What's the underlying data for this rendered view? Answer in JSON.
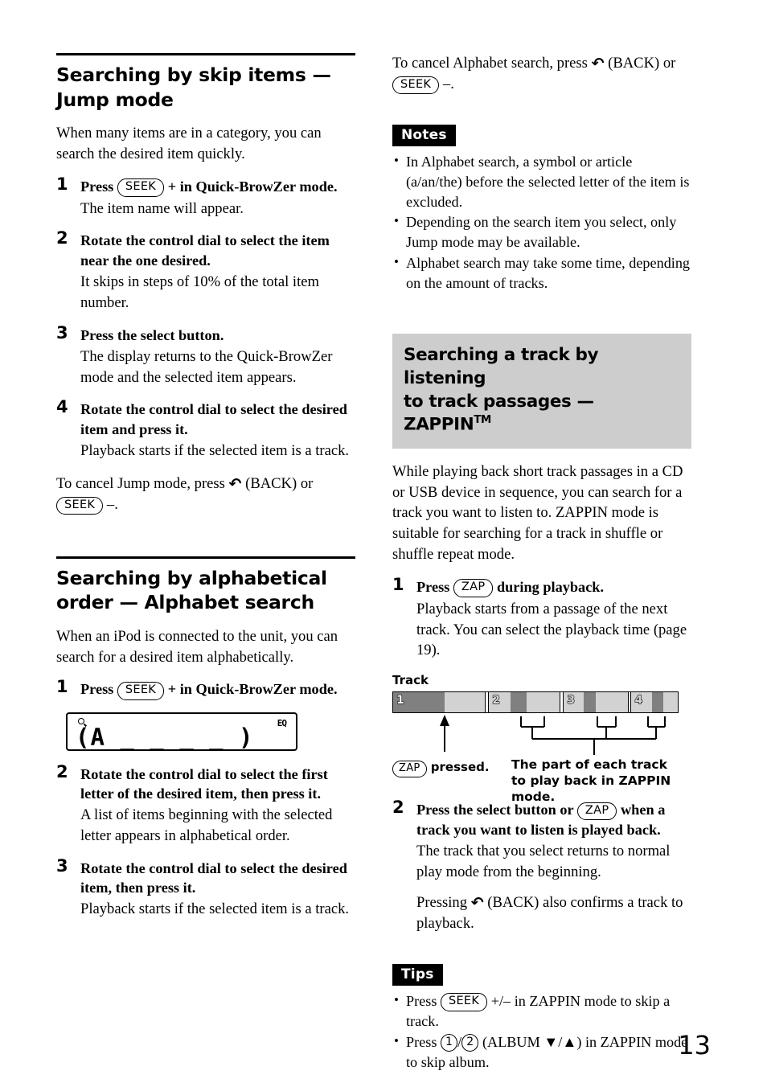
{
  "page": {
    "number": "13"
  },
  "left_column": {
    "section1": {
      "title": "Searching by skip items — Jump mode",
      "intro": "When many items are in a category, you can search the desired item quickly.",
      "steps": [
        {
          "num": "1",
          "lead_pre": "Press",
          "lead_key": "SEEK",
          "lead_post": "+ in Quick-BrowZer mode.",
          "sub": "The item name will appear."
        },
        {
          "num": "2",
          "lead": "Rotate the control dial to select the item near the one desired.",
          "sub": "It skips in steps of 10% of the total item number."
        },
        {
          "num": "3",
          "lead": "Press the select button.",
          "sub": "The display returns to the Quick-BrowZer mode and the selected item appears."
        },
        {
          "num": "4",
          "lead": "Rotate the control dial to select the desired item and press it.",
          "sub": "Playback starts if the selected item is a track."
        }
      ],
      "cancel_pre": "To cancel Jump mode, press",
      "cancel_back_icon": "back-arrow-icon",
      "cancel_mid": "(BACK) or",
      "cancel_key": "SEEK",
      "cancel_post": "–."
    },
    "section2": {
      "title": "Searching by alphabetical order — Alphabet search",
      "intro": "When an iPod is connected to the unit, you can search for a desired item alphabetically.",
      "steps": [
        {
          "num": "1",
          "lead_pre": "Press",
          "lead_key": "SEEK",
          "lead_post": "+ in Quick-BrowZer mode."
        },
        {
          "num": "2",
          "lead": "Rotate the control dial to select the first letter of the desired item, then press it.",
          "sub": "A list of items beginning with the selected letter appears in alphabetical order."
        },
        {
          "num": "3",
          "lead": "Rotate the control dial to select the desired item, then press it.",
          "sub": "Playback starts if the selected item is a track."
        }
      ],
      "lcd": {
        "magnifier_icon": "search-icon",
        "eq_indicator": "EQ",
        "segment_text": "(A _ _ _ _ )"
      }
    }
  },
  "right_column": {
    "cancel_alphabet": {
      "pre": "To cancel Alphabet search, press",
      "back_icon": "back-arrow-icon",
      "mid": "(BACK) or",
      "key": "SEEK",
      "post": "–."
    },
    "notes": {
      "label": "Notes",
      "items": [
        "In Alphabet search, a symbol or article (a/an/the) before the selected letter of the item is excluded.",
        "Depending on the search item you select, only Jump mode may be available.",
        "Alphabet search may take some time, depending on the amount of tracks."
      ]
    },
    "section3": {
      "title_line1": "Searching a track by listening",
      "title_line2": "to track passages — ZAPPIN",
      "title_tm": "TM",
      "intro": "While playing back short track passages in a CD or USB device in sequence, you can search for a track you want to listen to. ZAPPIN mode is suitable for searching for a track in shuffle or shuffle repeat mode.",
      "steps": [
        {
          "num": "1",
          "lead_pre": "Press",
          "lead_key": "ZAP",
          "lead_post": "during playback.",
          "sub": "Playback starts from a passage of the next track. You can select the playback time (page 19)."
        },
        {
          "num": "2",
          "lead_pre": "Press the select button or",
          "lead_key": "ZAP",
          "lead_post": "when a track you want to listen is played back.",
          "sub": "The track that you select returns to normal play mode from the beginning.",
          "sub2_pre": "Pressing",
          "sub2_icon": "back-arrow-icon",
          "sub2_post": "(BACK) also confirms a track to playback."
        }
      ],
      "figure": {
        "caption_top": "Track",
        "track_labels": [
          "1",
          "2",
          "3",
          "4"
        ],
        "zap_key": "ZAP",
        "zap_pressed_text": "pressed.",
        "part_label": "The part of each track to play back in ZAPPIN mode."
      }
    },
    "tips": {
      "label": "Tips",
      "items": [
        {
          "pre": "Press",
          "key": "SEEK",
          "post": "+/– in ZAPPIN mode to skip a track."
        },
        {
          "pre": "Press",
          "key1": "1",
          "sep": "/",
          "key2": "2",
          "post": "(ALBUM ▼/▲) in ZAPPIN mode to skip album."
        }
      ]
    }
  },
  "colors": {
    "heading_box_bg": "#cdcdcd",
    "tag_bg": "#000000",
    "track_dark": "#808080",
    "track_light": "#d2d2d2"
  }
}
